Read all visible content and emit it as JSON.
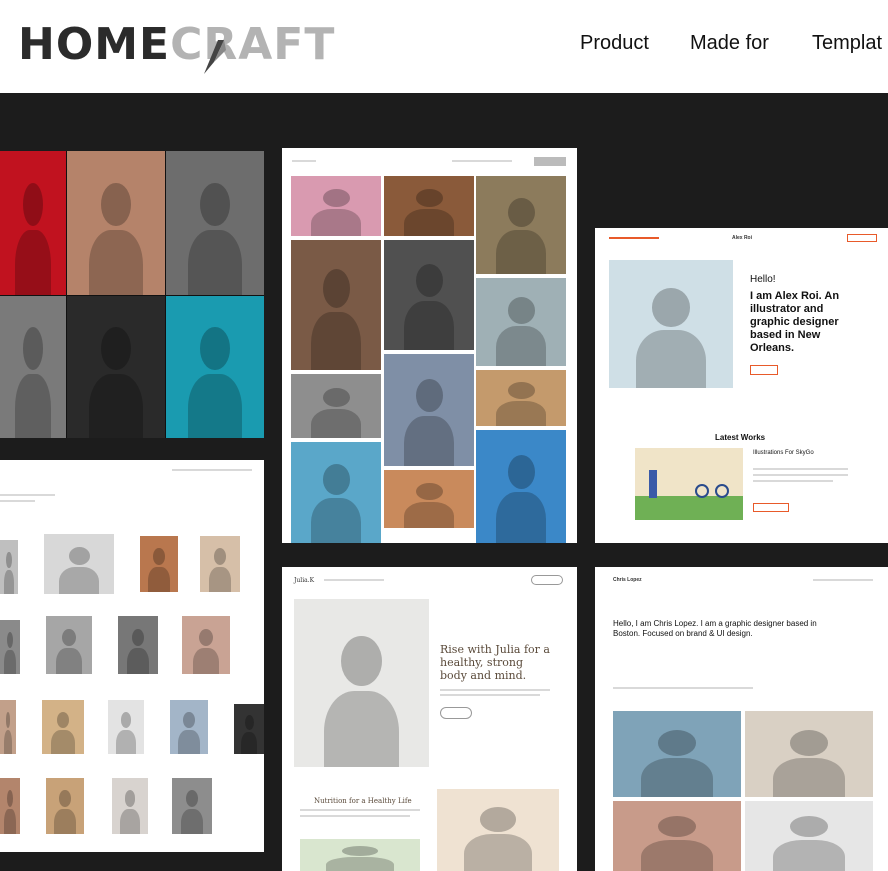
{
  "brand": {
    "part1": "HOME",
    "part2": "CRAFT"
  },
  "nav": {
    "items": [
      "Product",
      "Made for",
      "Templat"
    ]
  },
  "alex": {
    "name": "Alex Roi",
    "hello": "Hello!",
    "headline": "I am Alex Roi. An illustrator and graphic designer based in New Orleans.",
    "section": "Latest Works",
    "work_title": "Illustrations For SkyGo"
  },
  "julia": {
    "logo": "Julia.K",
    "headline": "Rise with Julia for a healthy, strong body and mind.",
    "sub": "Nutrition for a Healthy Life"
  },
  "chris": {
    "name": "Chris Lopez",
    "headline": "Hello, I am Chris Lopez. I am a graphic designer based in Boston. Focused on brand & UI design."
  },
  "colors": {
    "accent": "#e85a2a",
    "background": "#1c1c1c"
  }
}
